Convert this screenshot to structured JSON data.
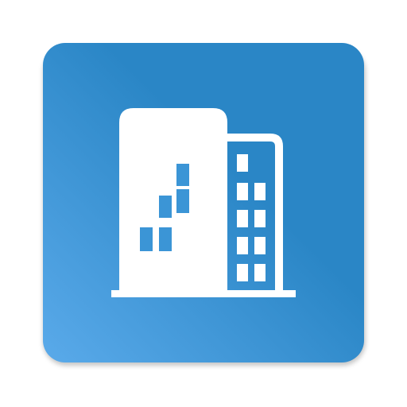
{
  "app_icon": {
    "icon": "office-buildings-icon",
    "colors": {
      "background_start": "#5aaaea",
      "background_end": "#2a86c6",
      "glyph": "#ffffff"
    }
  }
}
